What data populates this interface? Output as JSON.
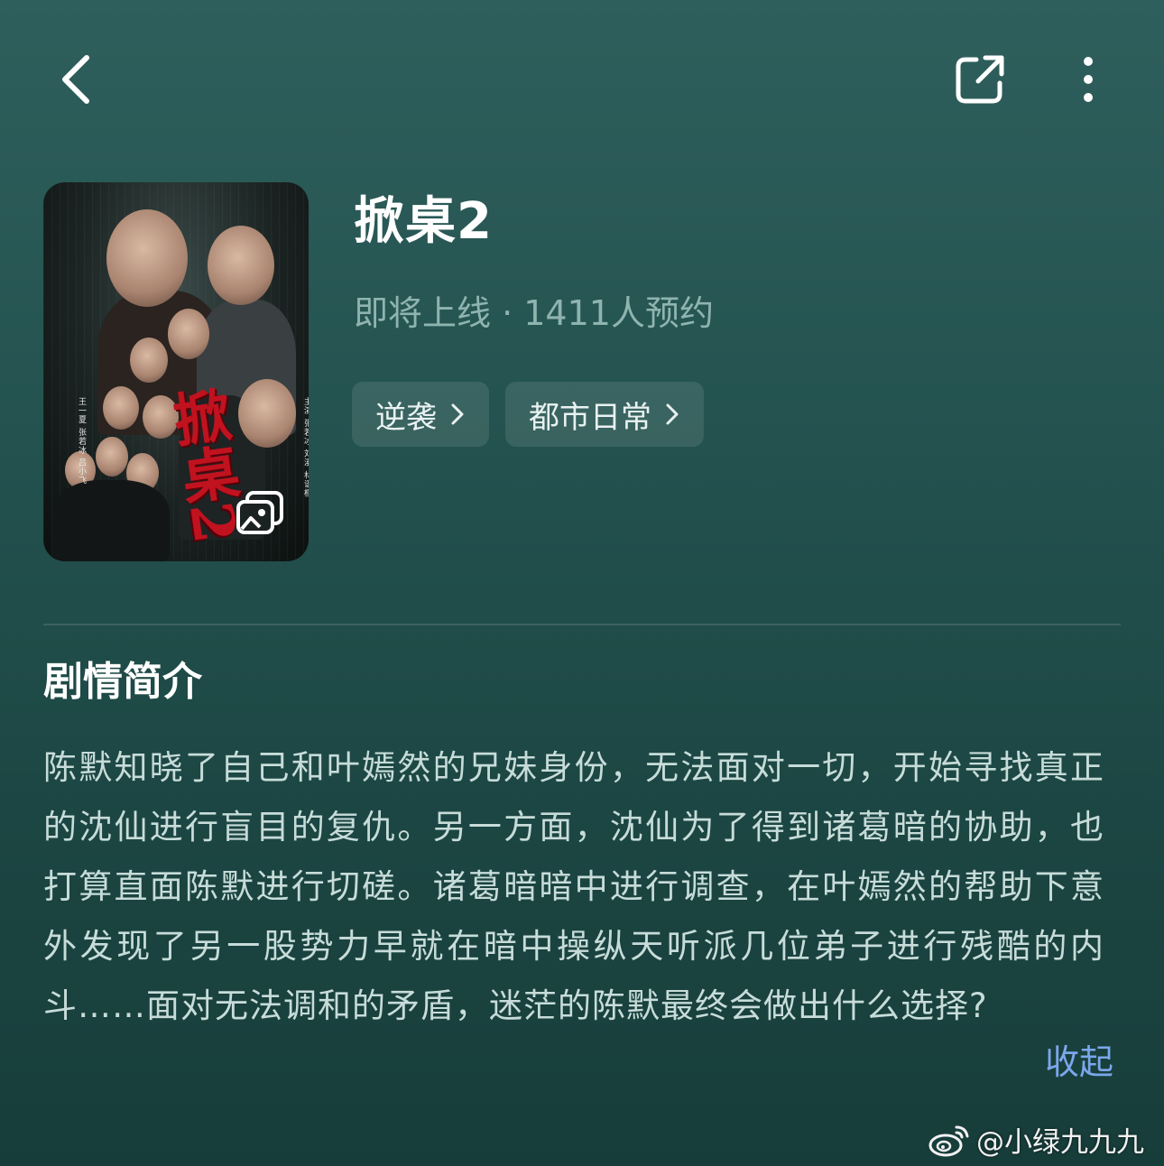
{
  "header": {
    "back_icon": "chevron-left-icon",
    "share_icon": "share-external-icon",
    "more_icon": "more-vertical-icon"
  },
  "show": {
    "title": "掀桌2",
    "status": "即将上线 · 1411人预约",
    "tags": [
      {
        "label": "逆袭"
      },
      {
        "label": "都市日常"
      }
    ],
    "poster": {
      "title_art": "掀桌2",
      "credits_left": "王一夏 张若冰 吕小飞",
      "credits_right": "主演 张若冰 刘漫 林语桐"
    }
  },
  "synopsis": {
    "heading": "剧情简介",
    "text": "陈默知晓了自己和叶嫣然的兄妹身份，无法面对一切，开始寻找真正的沈仙进行盲目的复仇。另一方面，沈仙为了得到诸葛暗的协助，也打算直面陈默进行切磋。诸葛暗暗中进行调查，在叶嫣然的帮助下意外发现了另一股势力早就在暗中操纵天听派几位弟子进行残酷的内斗……面对无法调和的矛盾，迷茫的陈默最终会做出什么选择?",
    "collapse_label": "收起"
  },
  "watermark": {
    "text": "@小绿九九九",
    "icon": "weibo-icon"
  },
  "colors": {
    "background_top": "#2f5f5c",
    "background_bottom": "#173d3a",
    "link": "#7da7ea",
    "muted": "#8fb4b0"
  }
}
